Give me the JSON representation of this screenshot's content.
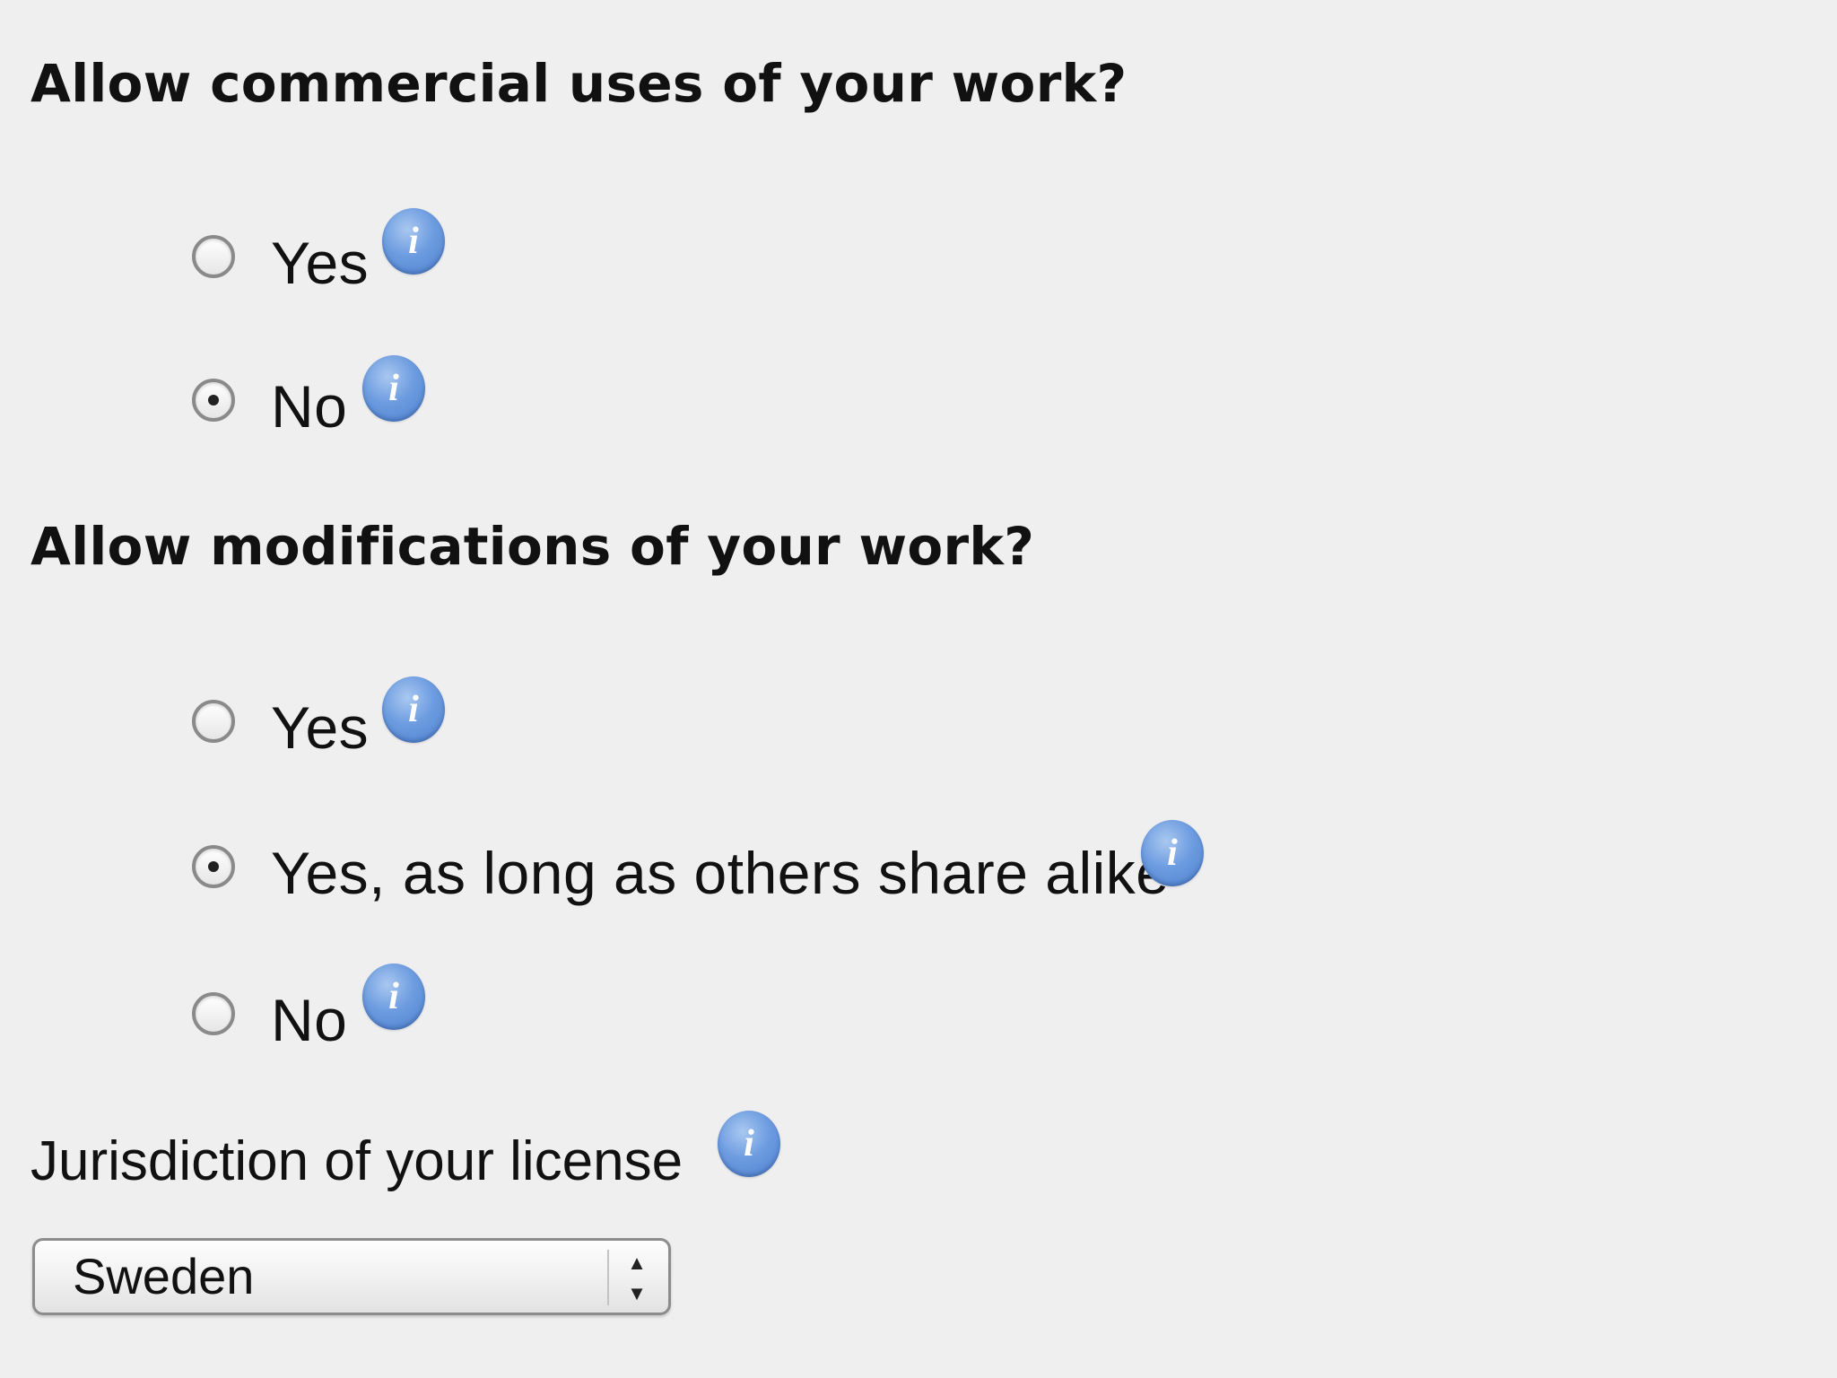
{
  "commercial": {
    "question": "Allow commercial uses of your work?",
    "options": [
      {
        "label": "Yes",
        "selected": false,
        "info_glyph": "i"
      },
      {
        "label": "No",
        "selected": true,
        "info_glyph": "i"
      }
    ]
  },
  "modifications": {
    "question": "Allow modifications of your work?",
    "options": [
      {
        "label": "Yes",
        "selected": false,
        "info_glyph": "i"
      },
      {
        "label": "Yes, as long as others share alike",
        "selected": true,
        "info_glyph": "i"
      },
      {
        "label": "No",
        "selected": false,
        "info_glyph": "i"
      }
    ]
  },
  "jurisdiction": {
    "label": "Jurisdiction of your license",
    "info_glyph": "i",
    "selected_value": "Sweden",
    "arrow_up": "▲",
    "arrow_down": "▼"
  },
  "colors": {
    "background": "#efeff0",
    "info_icon": "#6d9ce0"
  }
}
